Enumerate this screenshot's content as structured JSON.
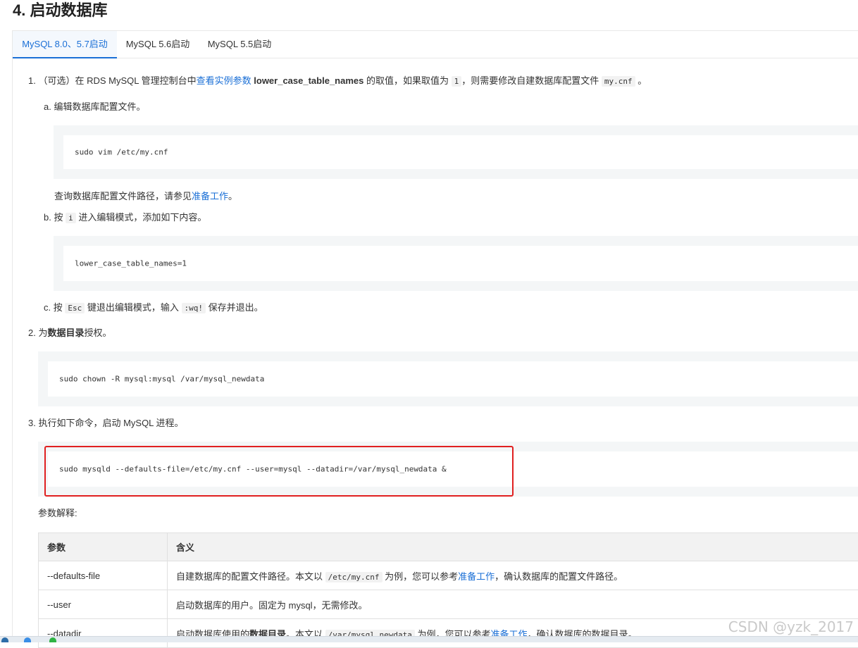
{
  "section_title": "4. 启动数据库",
  "tabs": [
    {
      "label": "MySQL 8.0、5.7启动",
      "active": true
    },
    {
      "label": "MySQL 5.6启动",
      "active": false
    },
    {
      "label": "MySQL 5.5启动",
      "active": false
    }
  ],
  "step1": {
    "num": "1.",
    "t1": "（可选）在 RDS MySQL 管理控制台中",
    "link": "查看实例参数",
    "bold": "lower_case_table_names",
    "t2": "的取值，如果取值为",
    "code1": "1",
    "t3": "，则需要修改自建数据库配置文件",
    "code2": "my.cnf",
    "t4": "。",
    "a": {
      "label": "a. 编辑数据库配置文件。",
      "code": "sudo vim /etc/my.cnf",
      "note_text": "查询数据库配置文件路径，请参见",
      "note_link": "准备工作",
      "note_end": "。"
    },
    "b": {
      "prefix": "b. 按",
      "key": "i",
      "suffix": "进入编辑模式，添加如下内容。",
      "code": "lower_case_table_names=1"
    },
    "c": {
      "prefix": "c. 按",
      "key": "Esc",
      "mid": "键退出编辑模式，输入",
      "cmd": ":wq!",
      "suffix": "保存并退出。"
    }
  },
  "step2": {
    "prefix": "2. 为",
    "bold": "数据目录",
    "suffix": "授权。",
    "code": "sudo chown -R mysql:mysql /var/mysql_newdata"
  },
  "step3": {
    "text": "3. 执行如下命令，启动 MySQL 进程。",
    "code": "sudo mysqld --defaults-file=/etc/my.cnf --user=mysql --datadir=/var/mysql_newdata &"
  },
  "params_label": "参数解释:",
  "table": {
    "headers": [
      "参数",
      "含义"
    ],
    "rows": [
      {
        "param": "--defaults-file",
        "d1": "自建数据库的配置文件路径。本文以",
        "code": "/etc/my.cnf",
        "d2": "为例，您可以参考",
        "link": "准备工作",
        "d3": "，确认数据库的配置文件路径。"
      },
      {
        "param": "--user",
        "d1": "启动数据库的用户。固定为 mysql，无需修改。"
      },
      {
        "param": "--datadir",
        "d1": "启动数据库使用的",
        "bold": "数据目录",
        "d1b": "。本文以",
        "code": "/var/mysql_newdata",
        "d2": "为例，您可以参考",
        "link": "准备工作",
        "d3": "，确认数据库的数据目录。"
      }
    ]
  },
  "watermark": "CSDN @yzk_2017",
  "colors": {
    "link": "#1a6fd6",
    "highlight_box": "#e02020",
    "code_bg": "#f4f6f7"
  }
}
